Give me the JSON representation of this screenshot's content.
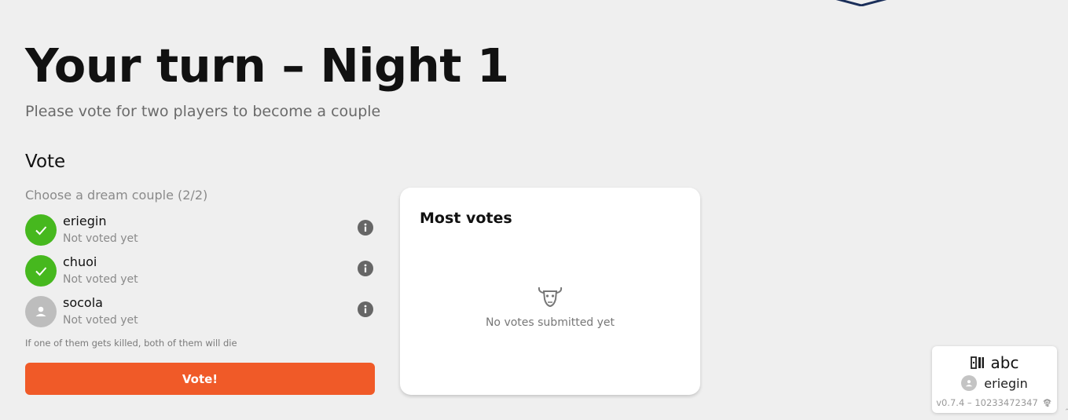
{
  "header": {
    "title": "Your turn – Night 1",
    "subtitle": "Please vote for two players to become a couple"
  },
  "vote": {
    "section_title": "Vote",
    "hint": "Choose a dream couple (2/2)",
    "players": [
      {
        "name": "eriegin",
        "status": "Not voted yet",
        "selected": true
      },
      {
        "name": "chuoi",
        "status": "Not voted yet",
        "selected": true
      },
      {
        "name": "socola",
        "status": "Not voted yet",
        "selected": false
      }
    ],
    "note": "If one of them gets killed, both of them will die",
    "button_label": "Vote!"
  },
  "most_votes": {
    "title": "Most votes",
    "empty_icon": "bull-skull-icon",
    "empty_text": "No votes submitted yet"
  },
  "session": {
    "icon": "game-room-icon",
    "game_name": "abc",
    "user_name": "eriegin",
    "version": "v0.7.4 – 10233472347",
    "fingerprint_icon": "fingerprint-icon"
  },
  "colors": {
    "background": "#efefef",
    "selected": "#46b81e",
    "accent": "#f05a28",
    "info": "#666666"
  }
}
